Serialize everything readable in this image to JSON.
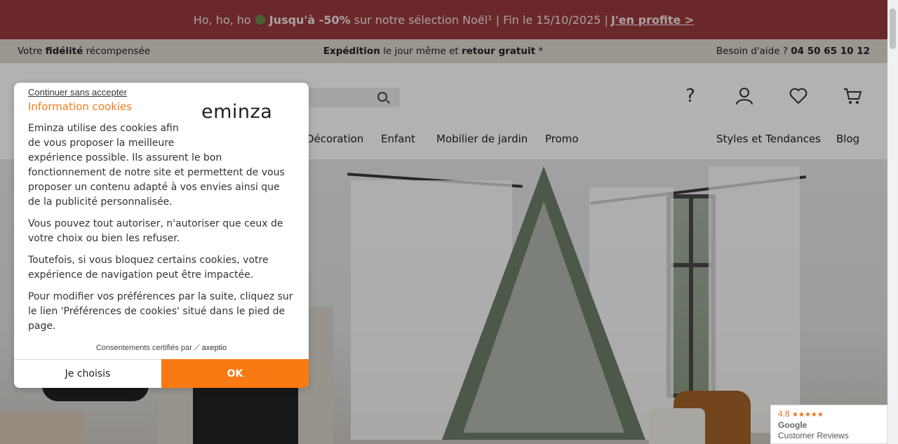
{
  "promo": {
    "prefix": "Ho, ho, ho",
    "highlight": "Jusqu'à -50%",
    "middle": "sur notre sélection Noël¹ | Fin le 15/10/2025 |",
    "link": "J'en profite >"
  },
  "infobar": {
    "left_a": "Votre ",
    "left_b": "fidélité",
    "left_c": " récompensée",
    "center_a": "Expédition",
    "center_b": " le jour même et ",
    "center_c": "retour gratuit",
    "center_d": " *",
    "right_a": "Besoin d'aide ? ",
    "right_b": "04 50 65 10 12"
  },
  "header": {
    "icons": [
      "help-icon",
      "account-icon",
      "wishlist-icon",
      "cart-icon"
    ]
  },
  "nav": {
    "items": [
      "Décoration",
      "Enfant",
      "Mobilier de jardin",
      "Promo",
      "Styles et Tendances",
      "Blog"
    ]
  },
  "cookie_modal": {
    "skip_link": "Continuer sans accepter",
    "title": "Information cookies",
    "logo": "eminza",
    "paragraphs": [
      "Eminza utilise des cookies afin de vous proposer la meilleure expérience possible. Ils assurent le bon fonctionnement de notre site et permettent de vous proposer un contenu adapté à vos envies ainsi que de la publicité personnalisée.",
      "Vous pouvez tout autoriser, n'autoriser que ceux de votre choix ou bien les refuser.",
      "Toutefois, si vous bloquez certains cookies, votre expérience de navigation peut être impactée.",
      "Pour modifier vos préférences par la suite, cliquez sur le lien 'Préférences de cookies' situé dans le pied de page."
    ],
    "certified_text": "Consentements certifiés par",
    "certified_brand": "axeptio",
    "choose_button": "Je choisis",
    "ok_button": "OK"
  },
  "reviews_badge": {
    "rating": "4.8",
    "stars": "★★★★★",
    "source": "Google",
    "label": "Customer Reviews"
  },
  "colors": {
    "promo_bg": "#9a3a3e",
    "info_bg": "#ded7cf",
    "accent_orange": "#f97a12",
    "title_orange": "#f07c1b"
  }
}
